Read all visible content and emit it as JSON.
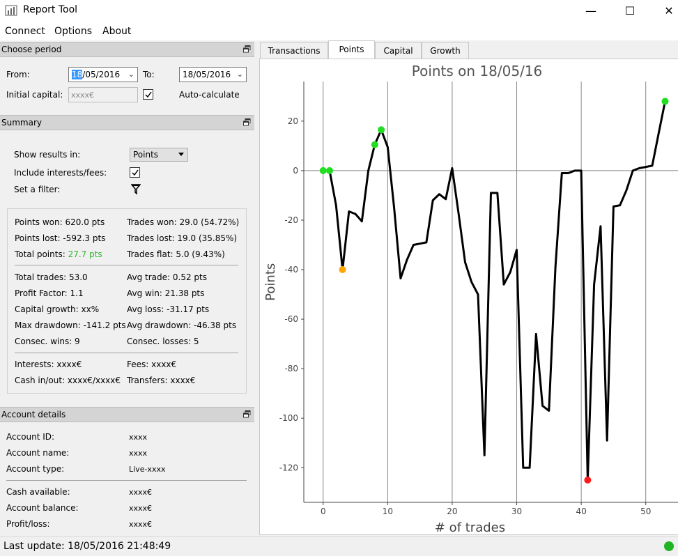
{
  "window": {
    "title": "Report Tool",
    "minimize": "—",
    "maximize": "☐",
    "close": "✕"
  },
  "menu": [
    "Connect",
    "Options",
    "About"
  ],
  "period": {
    "header": "Choose period",
    "from_label": "From:",
    "from_value_sel": "18",
    "from_value_rest": "/05/2016",
    "to_label": "To:",
    "to_value": "18/05/2016",
    "capital_label": "Initial capital:",
    "capital_value": "xxxx€",
    "auto_label": "Auto-calculate"
  },
  "summary": {
    "header": "Summary",
    "show_label": "Show results in:",
    "show_value": "Points",
    "interests_label": "Include interests/fees:",
    "filter_label": "Set a filter:",
    "points_won": "Points won: 620.0 pts",
    "points_lost": "Points lost: -592.3 pts",
    "total_points_label": "Total points: ",
    "total_points_value": "27.7 pts",
    "trades_won": "Trades won: 29.0 (54.72%)",
    "trades_lost": "Trades lost: 19.0 (35.85%)",
    "trades_flat": "Trades flat: 5.0 (9.43%)",
    "total_trades": "Total trades: 53.0",
    "profit_factor": "Profit Factor: 1.1",
    "capital_growth": "Capital growth: xx%",
    "max_drawdown": "Max drawdown: -141.2 pts",
    "consec_wins": "Consec. wins: 9",
    "avg_trade": "Avg trade: 0.52 pts",
    "avg_win": "Avg win: 21.38 pts",
    "avg_loss": "Avg loss: -31.17 pts",
    "avg_drawdown": "Avg drawdown: -46.38 pts",
    "consec_losses": "Consec. losses: 5",
    "interests": "Interests: xxxx€",
    "cash_inout": "Cash in/out: xxxx€/xxxx€",
    "fees": "Fees: xxxx€",
    "transfers": "Transfers: xxxx€"
  },
  "account": {
    "header": "Account details",
    "rows": [
      {
        "label": "Account ID:",
        "value": "xxxx"
      },
      {
        "label": "Account name:",
        "value": "xxxx"
      },
      {
        "label": "Account type:",
        "value": "Live-xxxx"
      },
      {
        "label": "Cash available:",
        "value": "xxxx€"
      },
      {
        "label": "Account balance:",
        "value": "xxxx€"
      },
      {
        "label": "Profit/loss:",
        "value": "xxxx€"
      }
    ]
  },
  "tabs": [
    "Transactions",
    "Points",
    "Capital",
    "Growth"
  ],
  "active_tab": 1,
  "status": {
    "text": "Last update: 18/05/2016 21:48:49",
    "color": "#22b422"
  },
  "chart_data": {
    "type": "line",
    "title": "Points on 18/05/16",
    "xlabel": "# of trades",
    "ylabel": "Points",
    "xlim": [
      -3,
      55
    ],
    "ylim": [
      -134,
      36
    ],
    "xticks": [
      0,
      10,
      20,
      30,
      40,
      50
    ],
    "yticks": [
      20,
      0,
      -20,
      -40,
      -60,
      -80,
      -100,
      -120
    ],
    "grid": "vertical lines at x ticks; horizontal line at y=0",
    "series": [
      {
        "color": "#000000",
        "x": [
          0,
          1,
          2,
          3,
          4,
          5,
          6,
          7,
          8,
          9,
          10,
          11,
          12,
          13,
          14,
          15,
          16,
          17,
          18,
          19,
          20,
          21,
          22,
          23,
          24,
          25,
          26,
          27,
          28,
          29,
          30,
          31,
          32,
          33,
          34,
          35,
          36,
          37,
          38,
          39,
          40,
          41,
          42,
          43,
          44,
          45,
          46,
          47,
          48,
          49,
          50,
          51,
          52,
          53
        ],
        "y": [
          0,
          0,
          -14,
          -40,
          -16.5,
          -17.5,
          -20.5,
          0,
          10.5,
          16.5,
          9.5,
          -15,
          -43.5,
          -36,
          -30,
          -29.5,
          -29,
          -12,
          -9.5,
          -11.5,
          1,
          -17.5,
          -37,
          -45,
          -50,
          -115,
          -9,
          -9,
          -46,
          -41,
          -32,
          -120,
          -120,
          -66,
          -95,
          -97,
          -39,
          -1,
          -1,
          0,
          0,
          -125,
          -46,
          -22.5,
          -109,
          -14.5,
          -14,
          -8,
          0,
          1,
          1.5,
          2,
          15,
          28
        ]
      }
    ],
    "markers": [
      {
        "x": 0,
        "y": 0,
        "color": "#22dd22"
      },
      {
        "x": 1,
        "y": 0,
        "color": "#22dd22"
      },
      {
        "x": 3,
        "y": -40,
        "color": "#ffa500"
      },
      {
        "x": 8,
        "y": 10.5,
        "color": "#22dd22"
      },
      {
        "x": 9,
        "y": 16.5,
        "color": "#22dd22"
      },
      {
        "x": 41,
        "y": -125,
        "color": "#ff1a1a"
      },
      {
        "x": 53,
        "y": 28,
        "color": "#22dd22"
      }
    ]
  }
}
